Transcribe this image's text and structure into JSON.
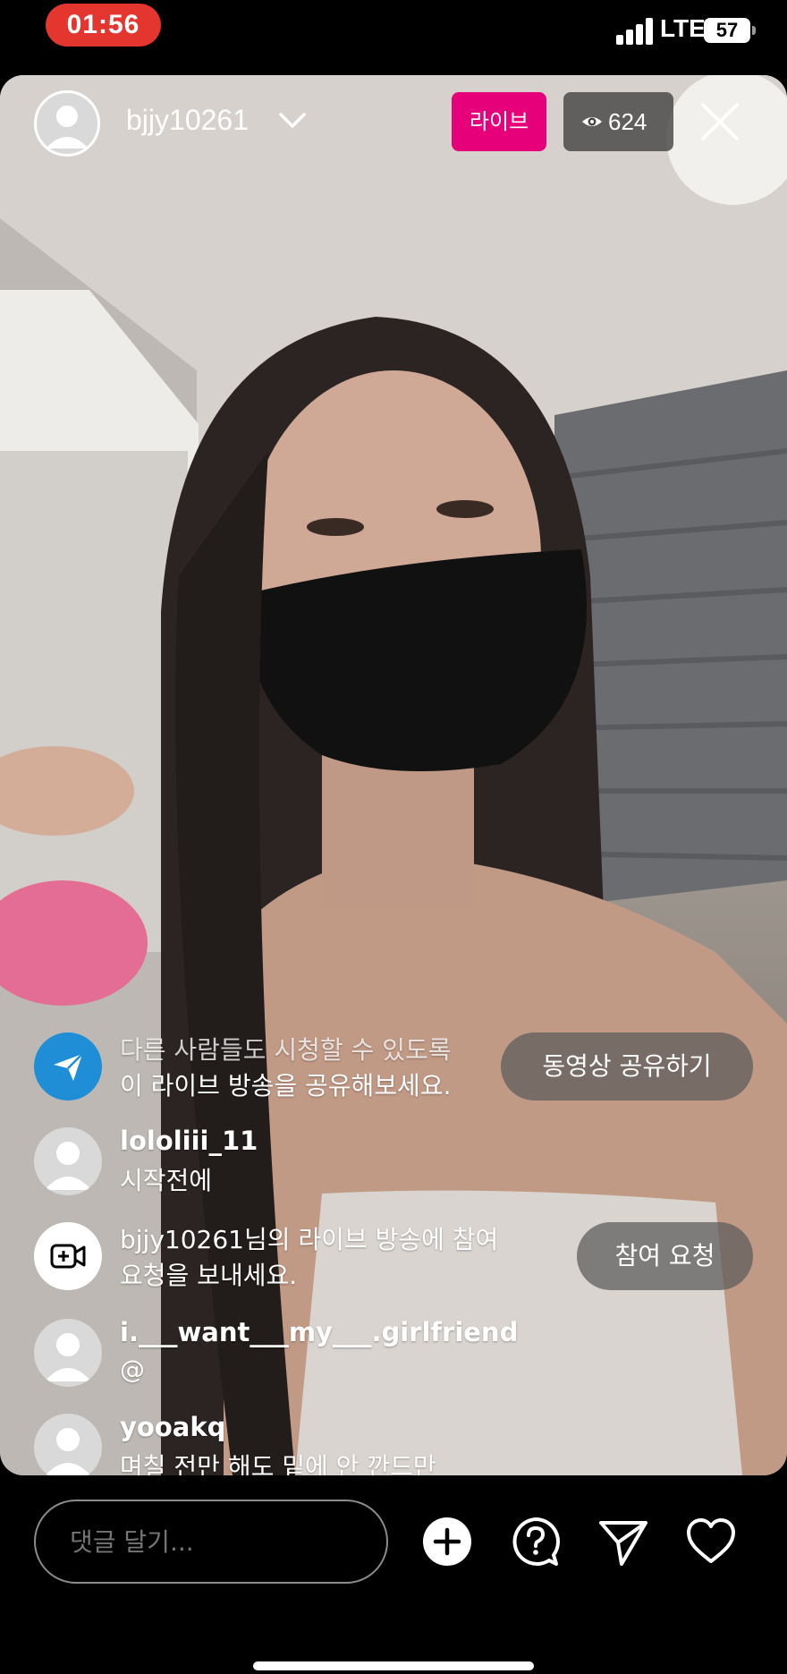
{
  "status_bar": {
    "time": "01:56",
    "network": "LTE",
    "battery": "57"
  },
  "host": {
    "username": "bjjy10261",
    "live_label": "라이브",
    "viewer_count": "624"
  },
  "share_prompt": {
    "line1": "다른 사람들도 시청할 수 있도록",
    "line2": "이 라이브 방송을 공유해보세요.",
    "button_label": "동영상 공유하기"
  },
  "join_prompt": {
    "line1": "bjjy10261님의 라이브 방송에 참여",
    "line2": "요청을 보내세요.",
    "button_label": "참여 요청"
  },
  "comments": [
    {
      "username": "lololiii_11",
      "text": "시작전에"
    },
    {
      "username": "i.___want___my___.girlfriend",
      "text": "@"
    },
    {
      "username": "yooakq",
      "text": "며칠 전만 해도 밑에 안 깐드만"
    }
  ],
  "comment_input": {
    "placeholder": "댓글 달기..."
  },
  "icons": {
    "add": "plus-circle-icon",
    "question": "question-bubble-icon",
    "send": "paper-plane-icon",
    "like": "heart-icon"
  },
  "colors": {
    "live_badge": "#e6007a",
    "time_pill": "#e5352f",
    "share_icon_bg": "#1f8ed6"
  }
}
